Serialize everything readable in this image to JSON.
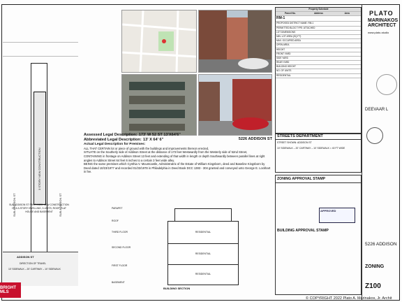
{
  "left_plan": {
    "lot_label": "SUB ADDISON ST PROPOSED NEW CONSTRUCTION OF A 3-STORY DWELLING, 3-UNITS, ROOF, FLAT HOUSE AND BASEMENT",
    "building_label": "3 STORY NEW CONSTRUCTION",
    "street_side_label": "SUB ADDISON ST",
    "direction": "DIRECTION OF TRAVEL",
    "sidewalk": "10' SIDEWALK – 20' CARTWAY – 10' SIDEWALK",
    "street_name": "ADDISON ST"
  },
  "legal": {
    "assessed_label": "Assessed Legal Description:",
    "assessed_value": "173' W 52 ST   13'X64'6\"",
    "abbrev_label": "Abbreviated Legal Description:",
    "abbrev_value": "13' X 64' 6\"",
    "address": "5226 ADDISON ST",
    "actual_label": "Actual Legal Description for Premises:",
    "p1": "ALL THAT CERTAIN lot or piece of ground with the buildings and improvements thereon erected,",
    "p2": "SITUATE on the Southerly side of Addison Street at the distance of 173 feet Westwardly from the Westerly side of 52nd Street,",
    "p3": "CONTAINING in frontage on Addison Street 13 feet and extending of that width in length or depth Southwardly between parallel lines at right angles to Addison Street 64 feet 6 inches to a certain 3 feet wide alley.",
    "p4": "BEING the same premises which Cynthia V. Mountcastle, Administratrix of the Estate of William Kingsborn, deed and Baseline Kingsborn by Deed dated 10/23/1977 and recorded 01/23/1978 in Philadelphia in Deed Book DCC 1383 - 304 granted and conveyed unto George E. Lockhart in fee."
  },
  "section": {
    "title": "BUILDING SECTION",
    "labels": [
      "PARAPET",
      "ROOF",
      "THIRD FLOOR",
      "SECOND FLOOR",
      "FIRST FLOOR",
      "BASEMENT"
    ],
    "rooms": [
      "RESIDENTIAL",
      "RESIDENTIAL",
      "RESIDENTIAL"
    ]
  },
  "schedule": {
    "title": "Property Schedule",
    "cols": [
      "Parcel No.",
      "Address",
      "Area"
    ],
    "zoning": "RM-1",
    "rows": [
      "PROPOSED DISTRICT NAME: RM-1",
      "PERMITTED BLDG TYPE: ATTACHED",
      "LOT DIMENSIONS",
      "MIN. LOT AREA (SQ FT)",
      "MAX. OCCUPIED AREA",
      "OPEN AREA",
      "HEIGHT",
      "FRONT YARD",
      "SIDE YARD",
      "REAR YARD",
      "BUILDING HEIGHT",
      "NO. OF UNITS",
      "RESIDENTIAL"
    ]
  },
  "streets": {
    "title": "STREETS DEPARTMENT",
    "line1": "STREET SHOWN: ADDISON ST",
    "line2": "10' SIDEWALK – 20' CARTWAY – 10' SIDEWALK = 40 FT WIDE",
    "zoning_stamp": "ZONING APPROVAL STAMP",
    "building_stamp": "BUILDING APPROVAL STAMP",
    "approved": "APPROVED"
  },
  "titleblock": {
    "firm1": "PLATO",
    "firm2": "MARINAKOS",
    "firm3": "ARCHITECT",
    "website": "www.plato-studio",
    "client": "DEEVAAR L",
    "project": "5226 ADDISON",
    "sheet_title": "ZONING",
    "sheet_no": "Z100"
  },
  "mls_badge": "BRIGHT MLS",
  "copyright": "© COPYRIGHT 2022  Plato A. Marinakos, Jr. Archit"
}
